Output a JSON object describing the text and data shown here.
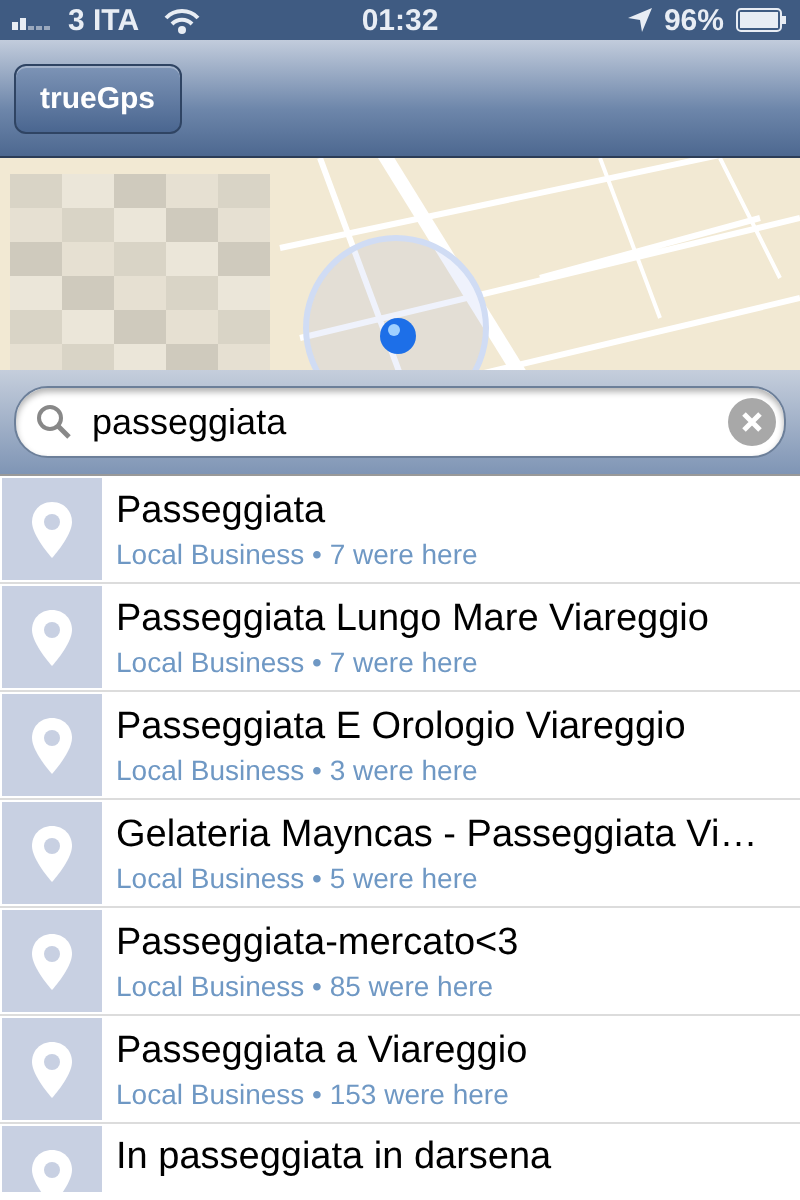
{
  "status_bar": {
    "carrier": "3 ITA",
    "time": "01:32",
    "battery": "96%"
  },
  "nav_bar": {
    "back_button": "trueGps"
  },
  "search": {
    "value": "passeggiata"
  },
  "results": [
    {
      "title": "Passeggiata",
      "subtitle": "Local Business • 7 were here"
    },
    {
      "title": "Passeggiata Lungo Mare Viareggio",
      "subtitle": "Local Business • 7 were here"
    },
    {
      "title": "Passeggiata E Orologio Viareggio",
      "subtitle": "Local Business • 3 were here"
    },
    {
      "title": "Gelateria Mayncas - Passeggiata Vi…",
      "subtitle": "Local Business • 5 were here"
    },
    {
      "title": "Passeggiata-mercato<3",
      "subtitle": "Local Business • 85 were here"
    },
    {
      "title": "Passeggiata a Viareggio",
      "subtitle": "Local Business • 153 were here"
    },
    {
      "title": "In passeggiata in darsena"
    }
  ]
}
